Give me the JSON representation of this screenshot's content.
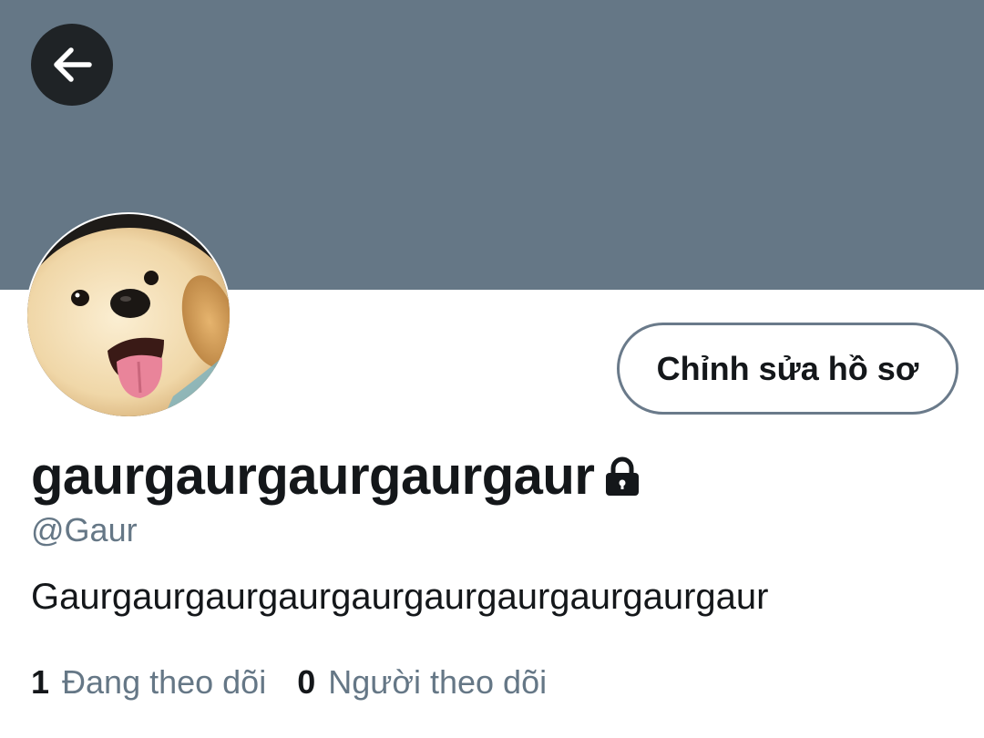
{
  "colors": {
    "banner": "#657786",
    "back_button_bg": "#1f2326",
    "text_primary": "#14171a",
    "text_secondary": "#657786",
    "button_border": "#6a7a8a"
  },
  "header": {
    "back_icon": "arrow-left-icon"
  },
  "profile": {
    "avatar_icon": "puppy-avatar",
    "edit_button_label": "Chỉnh sửa hồ sơ",
    "display_name": "gaurgaurgaurgaurgaur",
    "lock_icon": "lock-icon",
    "handle": "@Gaur",
    "bio": "Gaurgaurgaurgaurgaurgaurgaurgaurgaurgaur"
  },
  "stats": {
    "following_count": "1",
    "following_label": "Đang theo dõi",
    "followers_count": "0",
    "followers_label": "Người theo dõi"
  }
}
